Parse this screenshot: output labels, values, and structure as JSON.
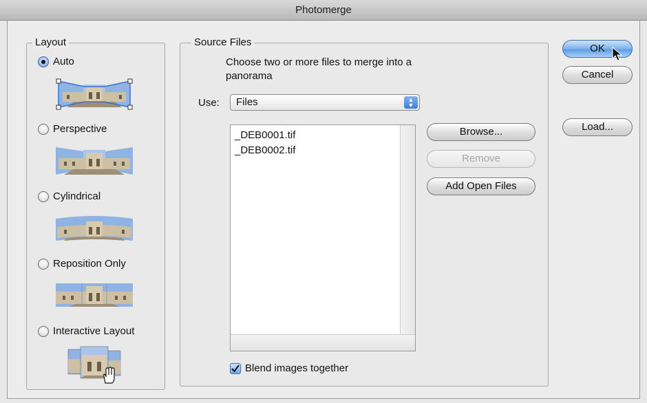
{
  "window": {
    "title": "Photomerge"
  },
  "layout": {
    "legend": "Layout",
    "options": [
      {
        "label": "Auto",
        "checked": true
      },
      {
        "label": "Perspective",
        "checked": false
      },
      {
        "label": "Cylindrical",
        "checked": false
      },
      {
        "label": "Reposition Only",
        "checked": false
      },
      {
        "label": "Interactive Layout",
        "checked": false
      }
    ]
  },
  "source": {
    "legend": "Source Files",
    "instructions": "Choose two or more files to merge into a panorama",
    "use_label": "Use:",
    "use_value": "Files",
    "files": [
      "_DEB0001.tif",
      "_DEB0002.tif"
    ],
    "browse": "Browse...",
    "remove": "Remove",
    "add_open": "Add Open Files",
    "blend_label": "Blend images together",
    "blend_checked": true
  },
  "actions": {
    "ok": "OK",
    "cancel": "Cancel",
    "load": "Load..."
  },
  "colors": {
    "accent": "#5f9de6",
    "sky": "#8fb4e3",
    "building": "#cdbfa3"
  },
  "icons": [
    "hand-cursor-icon",
    "arrow-cursor-icon",
    "checkmark-icon",
    "updown-arrows-icon"
  ]
}
